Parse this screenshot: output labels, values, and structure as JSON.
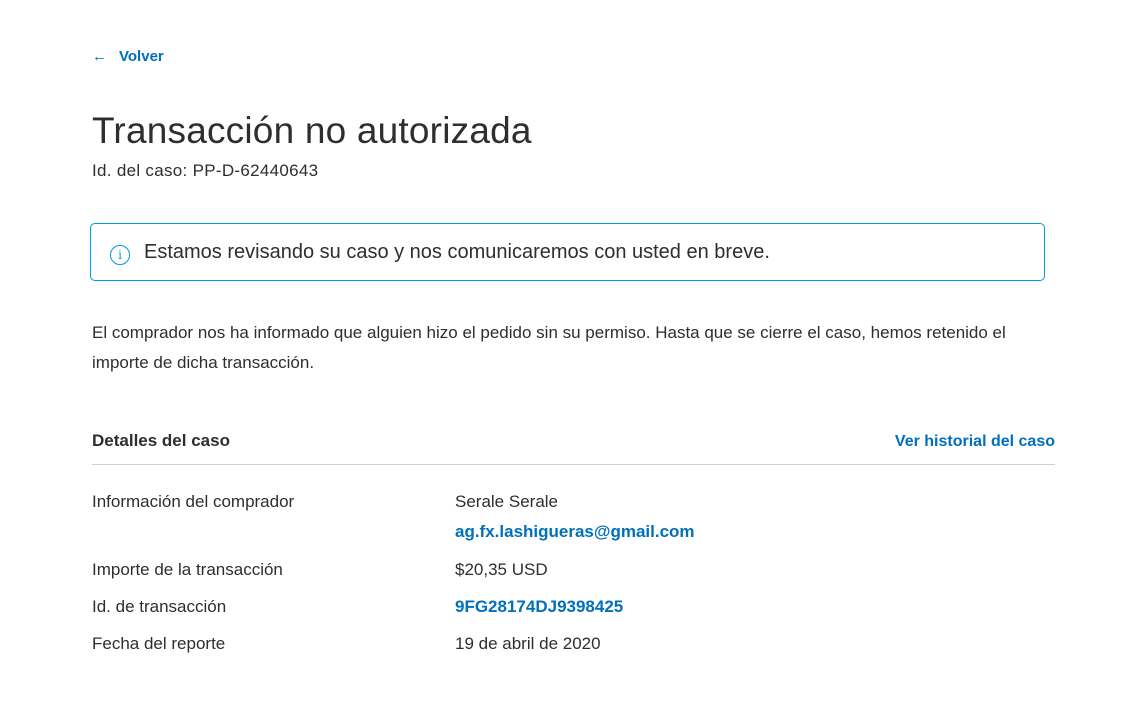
{
  "nav": {
    "back_label": "Volver",
    "back_icon": "arrow-left-icon"
  },
  "header": {
    "title": "Transacción no autorizada",
    "case_id": "Id. del caso: PP-D-62440643"
  },
  "notice": {
    "icon": "info-icon",
    "message": "Estamos revisando su caso y nos comunicaremos con usted en breve."
  },
  "description": "El comprador nos ha informado que alguien hizo el pedido sin su permiso. Hasta que se cierre el caso, hemos retenido el importe de dicha transacción.",
  "details": {
    "heading": "Detalles del caso",
    "history_link": "Ver historial del caso",
    "buyer_label": "Información del comprador",
    "buyer_name": "Serale Serale",
    "buyer_email": "ag.fx.lashigueras@gmail.com",
    "amount_label": "Importe de la transacción",
    "amount_value": "$20,35 USD",
    "txn_label": "Id. de transacción",
    "txn_value": "9FG28174DJ9398425",
    "date_label": "Fecha del reporte",
    "date_value": "19 de abril de 2020"
  },
  "colors": {
    "link": "#0070ba",
    "notice_border": "#009cde",
    "text": "#2c2e2f"
  }
}
